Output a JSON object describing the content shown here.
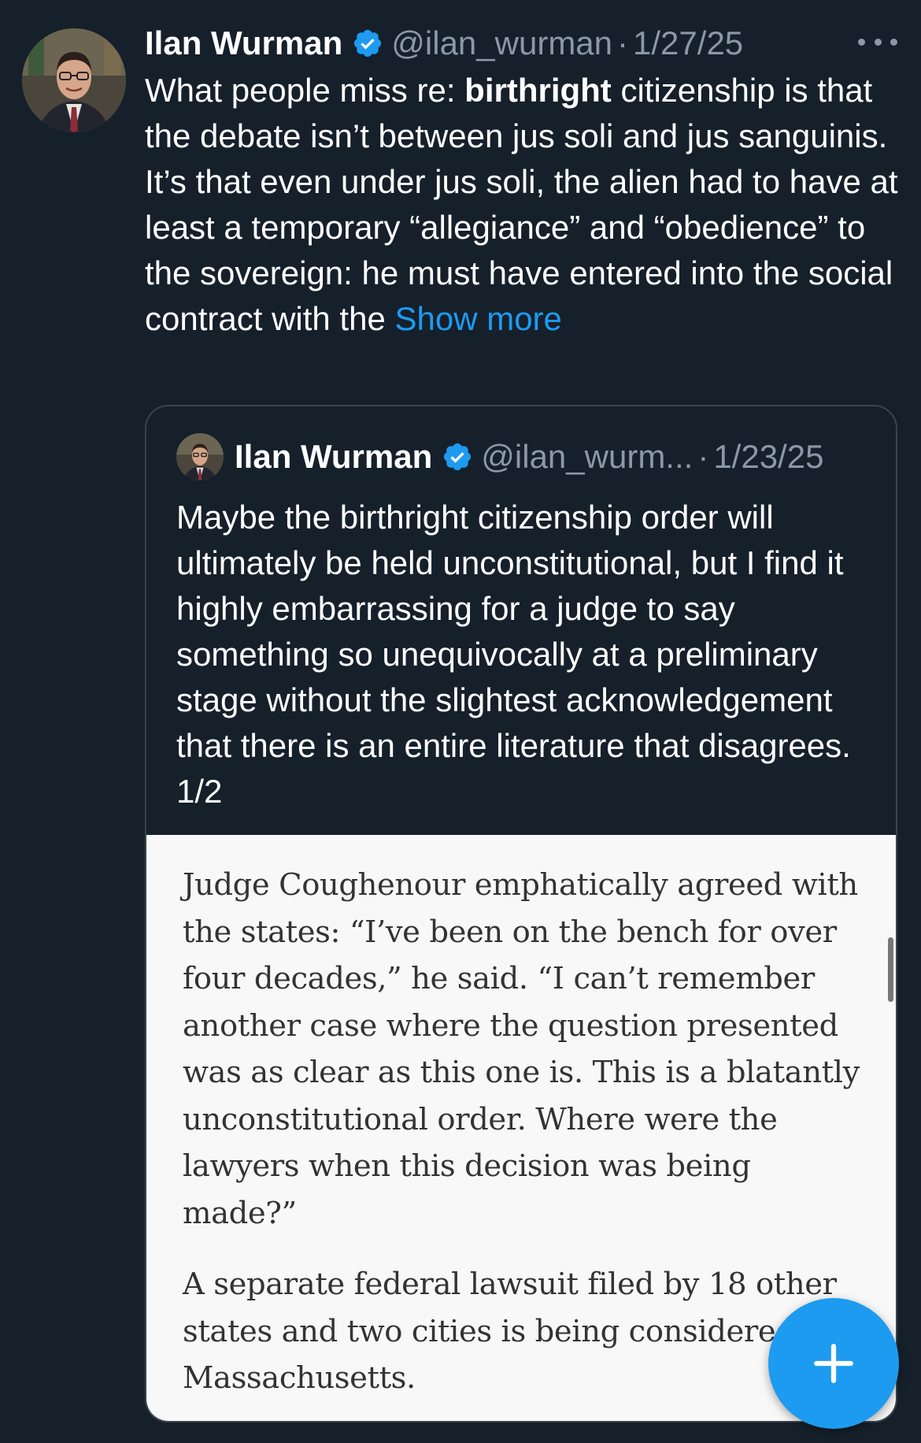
{
  "tweet": {
    "author_name": "Ilan Wurman",
    "handle": "@ilan_wurman",
    "separator": "·",
    "date": "1/27/25",
    "verified_icon": "verified-badge-icon",
    "more_icon": "more-options-icon",
    "text_before": "What people miss re: ",
    "text_bold": "birthright",
    "text_after": " citizenship is that the debate isn’t between jus soli and jus sanguinis. It’s that even under jus soli, the alien had to have at least a temporary “allegiance” and “obedience” to the sovereign: he must have entered into the social contract with the ",
    "show_more": "Show more"
  },
  "quote": {
    "author_name": "Ilan Wurman",
    "handle": "@ilan_wurm...",
    "separator": "·",
    "date": "1/23/25",
    "text": "Maybe the birthright citizenship order will ultimately be held unconstitutional, but I find it highly embarrassing for a judge to say something so unequivocally at a preliminary stage without the slightest acknowledgement that there is an entire literature that disagrees. 1/2",
    "image_paragraphs": [
      "Judge Coughenour emphatically agreed with the states: “I’ve been on the bench for over four decades,” he said. “I can’t remember another case where the question presented was as clear as this one is. This is a blatantly unconstitutional order. Where were the lawyers when this decision was being made?”",
      "A separate federal lawsuit filed by 18 other states and two cities is being considered in Massachusetts."
    ]
  },
  "fab": {
    "icon": "plus-icon"
  },
  "colors": {
    "background": "#15202b",
    "accent": "#1d9bf0",
    "secondary_text": "#8b98a5",
    "border": "#38444d"
  }
}
